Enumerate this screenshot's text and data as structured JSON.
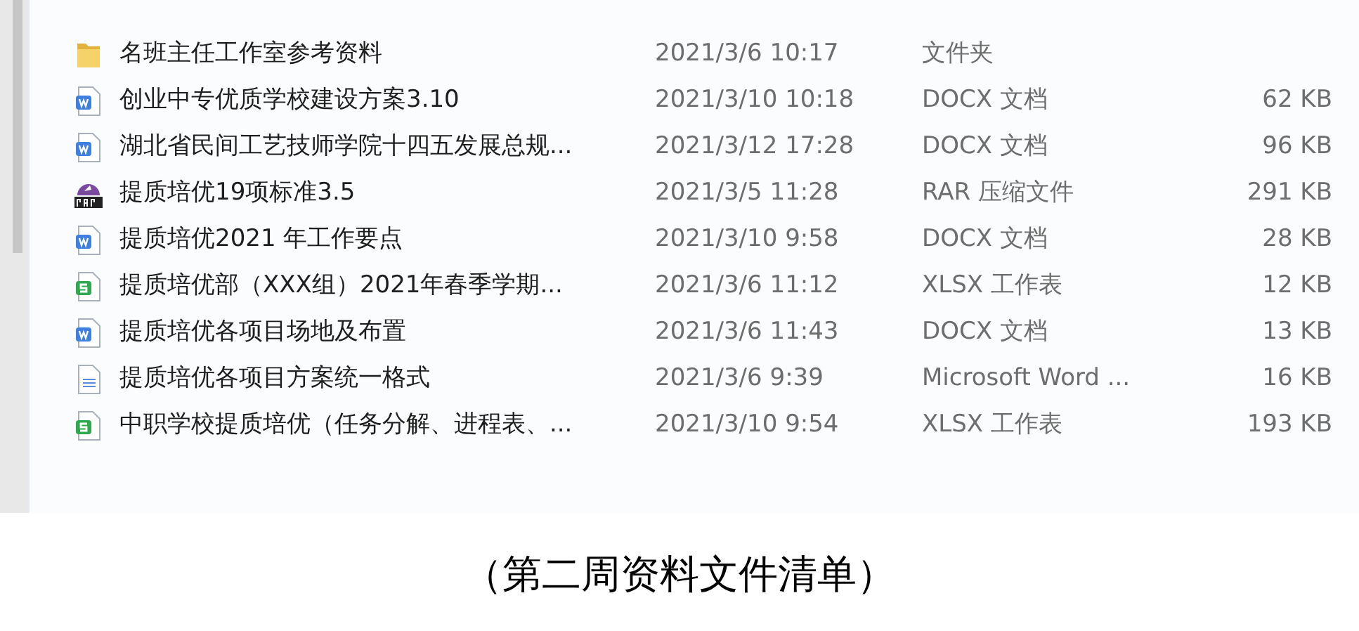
{
  "files": [
    {
      "kind": "folder",
      "name": "名班主任工作室参考资料",
      "modified": "2021/3/6 10:17",
      "type": "文件夹"
    },
    {
      "kind": "word",
      "name": "创业中专优质学校建设方案3.10",
      "modified": "2021/3/10 10:18",
      "type": "DOCX 文档",
      "size": "62 KB"
    },
    {
      "kind": "word",
      "name": "湖北省民间工艺技师学院十四五发展总规...",
      "modified": "2021/3/12 17:28",
      "type": "DOCX 文档",
      "size": "96 KB"
    },
    {
      "kind": "rar",
      "name": "提质培优19项标准3.5",
      "modified": "2021/3/5 11:28",
      "type": "RAR 压缩文件",
      "size": "291 KB"
    },
    {
      "kind": "word",
      "name": "提质培优2021 年工作要点",
      "modified": "2021/3/10 9:58",
      "type": "DOCX 文档",
      "size": "28 KB"
    },
    {
      "kind": "sheet",
      "name": "提质培优部（XXX组）2021年春季学期...",
      "modified": "2021/3/6 11:12",
      "type": "XLSX 工作表",
      "size": "12 KB"
    },
    {
      "kind": "word",
      "name": "提质培优各项目场地及布置",
      "modified": "2021/3/6 11:43",
      "type": "DOCX 文档",
      "size": "13 KB"
    },
    {
      "kind": "doc",
      "name": "提质培优各项目方案统一格式",
      "modified": "2021/3/6 9:39",
      "type": "Microsoft Word ...",
      "size": "16 KB"
    },
    {
      "kind": "sheet",
      "name": "中职学校提质培优（任务分解、进程表、...",
      "modified": "2021/3/10 9:54",
      "type": "XLSX 工作表",
      "size": "193 KB"
    }
  ],
  "caption": "（第二周资料文件清单）"
}
